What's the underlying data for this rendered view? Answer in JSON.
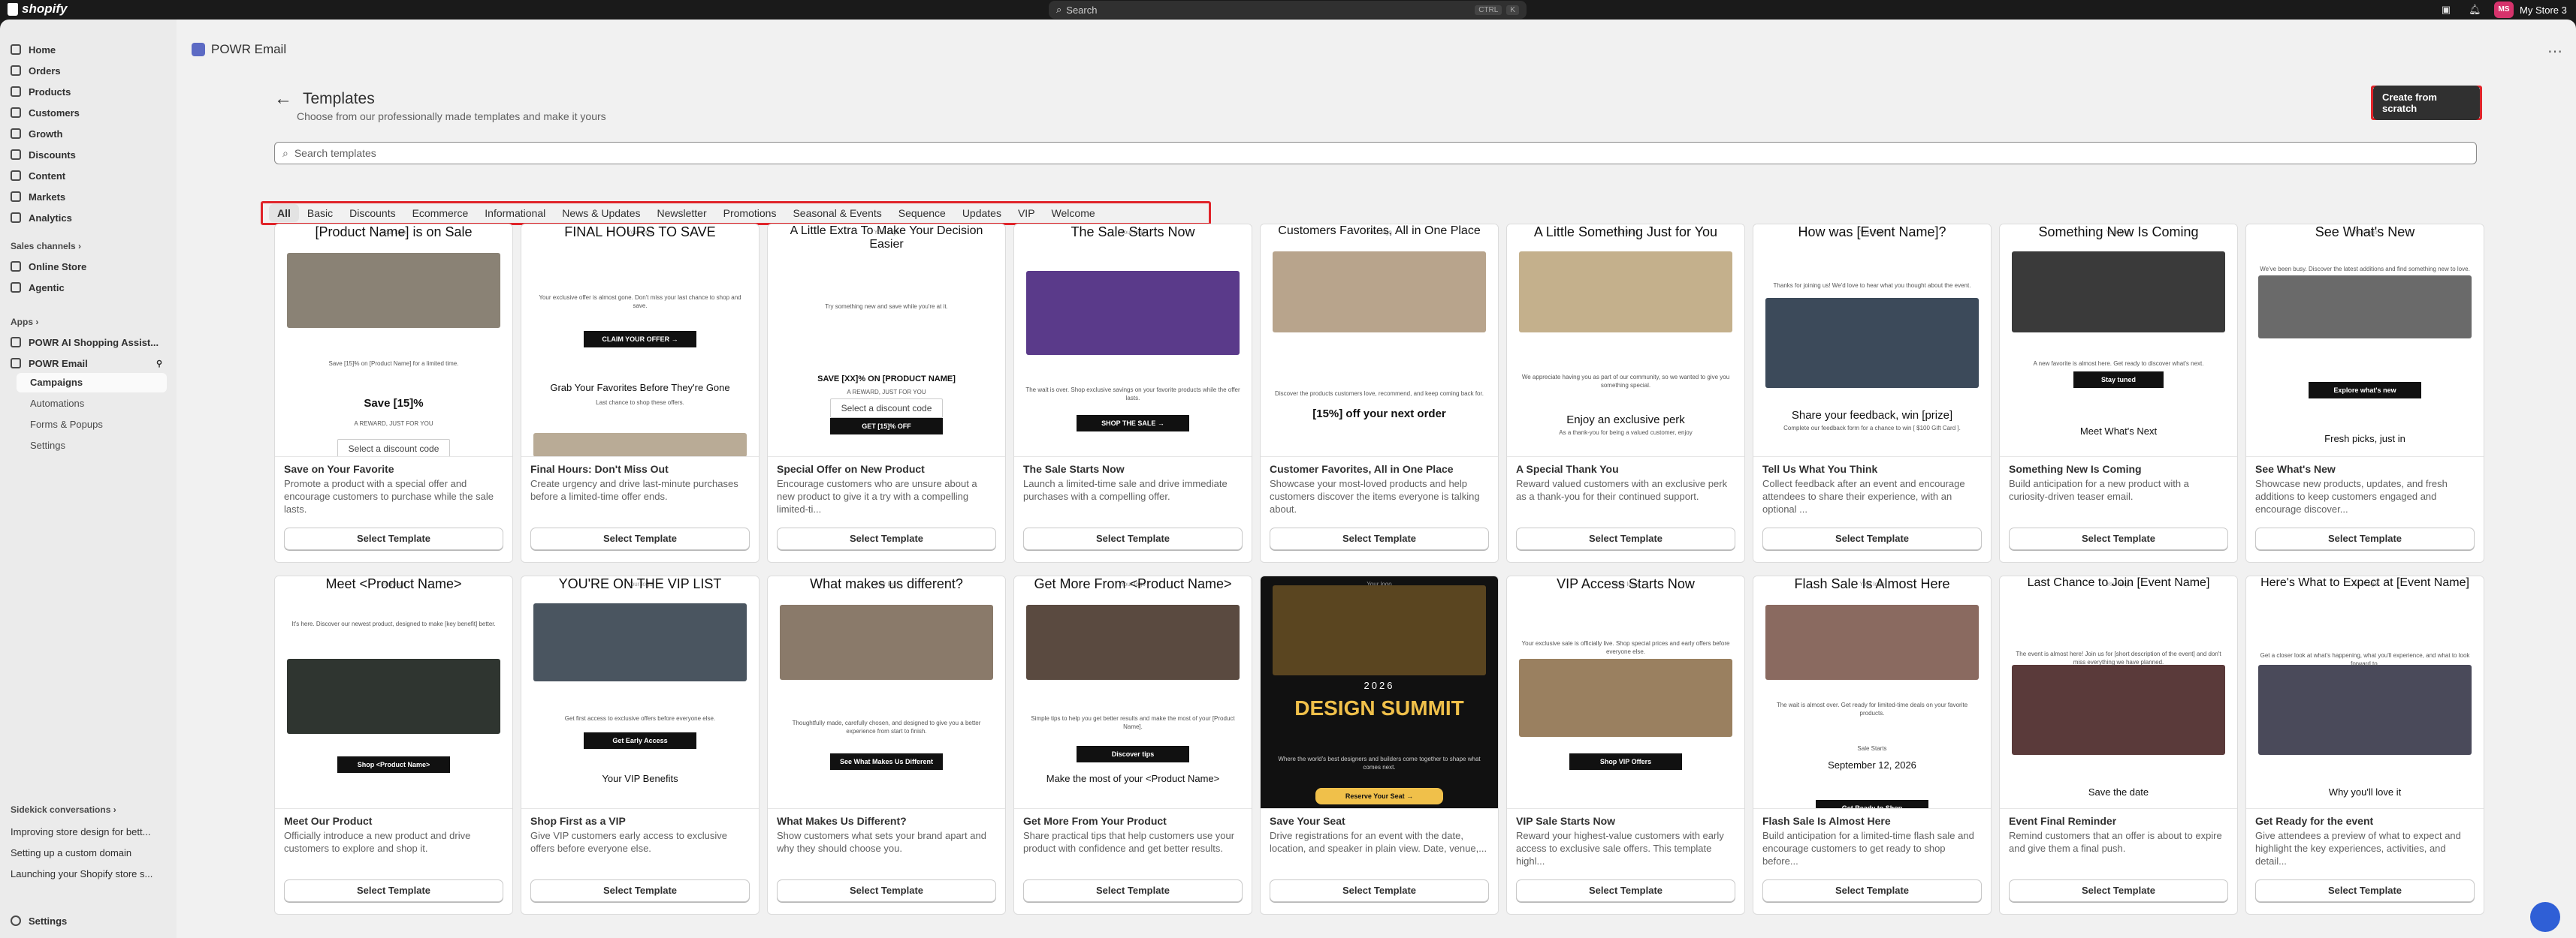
{
  "topbar": {
    "logo": "shopify",
    "search_placeholder": "Search",
    "search_kbd_1": "CTRL",
    "search_kbd_2": "K",
    "store_initials": "MS",
    "store_name": "My Store 3"
  },
  "sidebar": {
    "items": [
      {
        "label": "Home"
      },
      {
        "label": "Orders"
      },
      {
        "label": "Products"
      },
      {
        "label": "Customers"
      },
      {
        "label": "Growth"
      },
      {
        "label": "Discounts"
      },
      {
        "label": "Content"
      },
      {
        "label": "Markets"
      },
      {
        "label": "Analytics"
      }
    ],
    "sales_channels_heading": "Sales channels ›",
    "channels": [
      {
        "label": "Online Store"
      },
      {
        "label": "Agentic"
      }
    ],
    "apps_heading": "Apps ›",
    "apps": [
      {
        "label": "POWR AI Shopping Assist..."
      },
      {
        "label": "POWR Email"
      }
    ],
    "app_subitems": [
      {
        "label": "Campaigns"
      },
      {
        "label": "Automations"
      },
      {
        "label": "Forms & Popups"
      },
      {
        "label": "Settings"
      }
    ],
    "sidekick_heading": "Sidekick conversations ›",
    "conversations": [
      {
        "label": "Improving store design for bett..."
      },
      {
        "label": "Setting up a custom domain"
      },
      {
        "label": "Launching your Shopify store s..."
      }
    ],
    "settings_label": "Settings"
  },
  "main": {
    "app_title": "POWR Email",
    "page_title": "Templates",
    "subtitle": "Choose from our professionally made templates and make it yours",
    "create_button": "Create from scratch",
    "search_placeholder": "Search templates",
    "tabs": [
      {
        "label": "All"
      },
      {
        "label": "Basic"
      },
      {
        "label": "Discounts"
      },
      {
        "label": "Ecommerce"
      },
      {
        "label": "Informational"
      },
      {
        "label": "News & Updates"
      },
      {
        "label": "Newsletter"
      },
      {
        "label": "Promotions"
      },
      {
        "label": "Seasonal & Events"
      },
      {
        "label": "Sequence"
      },
      {
        "label": "Updates"
      },
      {
        "label": "VIP"
      },
      {
        "label": "Welcome"
      }
    ],
    "select_label": "Select Template",
    "preview_logo": "Your logo",
    "cards": [
      {
        "title": "Save on Your Favorite",
        "desc": "Promote a product with a special offer and encourage customers to purchase while the sale lasts.",
        "headline": "[Product Name] is on Sale",
        "text": "Save [15]% on [Product Name] for a limited time.",
        "extra": "Save [15]%",
        "code": "Select a discount code",
        "sub": "A REWARD, JUST FOR YOU",
        "img_color": "#8a8275"
      },
      {
        "title": "Final Hours: Don't Miss Out",
        "desc": "Create urgency and drive last-minute purchases before a limited-time offer ends.",
        "headline": "FINAL HOURS TO SAVE",
        "text": "Your exclusive offer is almost gone. Don't miss your last chance to shop and save.",
        "button": "CLAIM YOUR OFFER →",
        "extra": "Grab Your Favorites Before They're Gone",
        "sub": "Last chance to shop these offers.",
        "img_color": "#b9ab96"
      },
      {
        "title": "Special Offer on New Product",
        "desc": "Encourage customers who are unsure about a new product to give it a try with a compelling limited-ti...",
        "headline": "A Little Extra To Make Your Decision Easier",
        "text": "Try something new and save while you're at it.",
        "extra": "SAVE [XX]% ON [PRODUCT NAME]",
        "sub": "A REWARD, JUST FOR YOU",
        "code": "Select a discount code",
        "button": "GET [15]% OFF"
      },
      {
        "title": "The Sale Starts Now",
        "desc": "Launch a limited-time sale and drive immediate purchases with a compelling offer.",
        "headline": "The Sale Starts Now",
        "text": "The wait is over. Shop exclusive savings on your favorite products while the offer lasts.",
        "button": "SHOP THE SALE →",
        "img_color": "#5a3a8a"
      },
      {
        "title": "Customer Favorites, All in One Place",
        "desc": "Showcase your most-loved products and help customers discover the items everyone is talking about.",
        "headline": "Customers Favorites, All in One Place",
        "text": "Discover the products customers love, recommend, and keep coming back for.",
        "extra": "[15%] off your next order",
        "img_color": "#b8a48c"
      },
      {
        "title": "A Special Thank You",
        "desc": "Reward valued customers with an exclusive perk as a thank-you for their continued support.",
        "headline": "A Little Something Just for You",
        "text": "We appreciate having you as part of our community, so we wanted to give you something special.",
        "extra": "Enjoy an exclusive perk",
        "sub": "As a thank-you for being a valued customer, enjoy",
        "img_color": "#c4b08c"
      },
      {
        "title": "Tell Us What You Think",
        "desc": "Collect feedback after an event and encourage attendees to share their experience, with an optional ...",
        "headline": "How was [Event Name]?",
        "text": "Thanks for joining us! We'd love to hear what you thought about the event.",
        "extra": "Share your feedback, win [prize]",
        "sub": "Complete our feedback form for a chance to win [ $100 Gift Card ].",
        "img_color": "#3c4a5a"
      },
      {
        "title": "Something New Is Coming",
        "desc": "Build anticipation for a new product with a curiosity-driven teaser email.",
        "headline": "Something New Is Coming",
        "text": "A new favorite is almost here. Get ready to discover what's next.",
        "button": "Stay tuned",
        "extra": "Meet What's Next",
        "img_color": "#3a3a3a"
      },
      {
        "title": "See What's New",
        "desc": "Showcase new products, updates, and fresh additions to keep customers engaged and encourage discover...",
        "headline": "See What's New",
        "text": "We've been busy. Discover the latest additions and find something new to love.",
        "button": "Explore what's new",
        "extra": "Fresh picks, just in",
        "img_color": "#6a6a6a"
      },
      {
        "title": "Meet Our Product",
        "desc": "Officially introduce a new product and drive customers to explore and shop it.",
        "headline": "Meet <Product Name>",
        "text": "It's here. Discover our newest product, designed to make [key benefit] better.",
        "button": "Shop <Product Name>",
        "img_color": "#2f3530"
      },
      {
        "title": "Shop First as a VIP",
        "desc": "Give VIP customers early access to exclusive offers before everyone else.",
        "headline": "YOU'RE ON THE VIP LIST",
        "text": "Get first access to exclusive offers before everyone else.",
        "button": "Get Early Access",
        "extra": "Your VIP Benefits",
        "img_color": "#4a5560"
      },
      {
        "title": "What Makes Us Different?",
        "desc": "Show customers what sets your brand apart and why they should choose you.",
        "headline": "What makes us different?",
        "text": "Thoughtfully made, carefully chosen, and designed to give you a better experience from start to finish.",
        "button": "See What Makes Us Different",
        "img_color": "#8a7a6a"
      },
      {
        "title": "Get More From Your Product",
        "desc": "Share practical tips that help customers use your product with confidence and get better results.",
        "headline": "Get More From <Product Name>",
        "text": "Simple tips to help you get better results and make the most of your [Product Name].",
        "button": "Discover tips",
        "extra": "Make the most of your <Product Name>",
        "img_color": "#5a4a40"
      },
      {
        "title": "Save Your Seat",
        "desc": "Drive registrations for an event with the date, location, and speaker in plain view. Date, venue,...",
        "headline": "DESIGN SUMMIT",
        "text": "Where the world's best designers and builders come together to shape what comes next.",
        "button": "Reserve Your Seat →",
        "extra": "2026",
        "img_color": "#2a2a2a"
      },
      {
        "title": "VIP Sale Starts Now",
        "desc": "Reward your highest-value customers with early access to exclusive sale offers. This template highl...",
        "headline": "VIP Access Starts Now",
        "text": "Your exclusive sale is officially live. Shop special prices and early offers before everyone else.",
        "button": "Shop VIP Offers",
        "img_color": "#9a8060"
      },
      {
        "title": "Flash Sale Is Almost Here",
        "desc": "Build anticipation for a limited-time flash sale and encourage customers to get ready to shop before...",
        "headline": "Flash Sale Is Almost Here",
        "text": "The wait is almost over. Get ready for limited-time deals on your favorite products.",
        "extra": "September 12, 2026",
        "sub": "Sale Starts",
        "button": "Get Ready to Shop",
        "img_color": "#8a6a60"
      },
      {
        "title": "Event Final Reminder",
        "desc": "Remind customers that an offer is about to expire and give them a final push.",
        "headline": "Last Chance to Join [Event Name]",
        "text": "The event is almost here! Join us for [short description of the event] and don't miss everything we have planned.",
        "extra": "Save the date",
        "img_color": "#5a3a3a"
      },
      {
        "title": "Get Ready for the event",
        "desc": "Give attendees a preview of what to expect and highlight the key experiences, activities, and detail...",
        "headline": "Here's What to Expect at [Event Name]",
        "text": "Get a closer look at what's happening, what you'll experience, and what to look forward to.",
        "extra": "Why you'll love it",
        "img_color": "#4a4a5a"
      }
    ]
  }
}
